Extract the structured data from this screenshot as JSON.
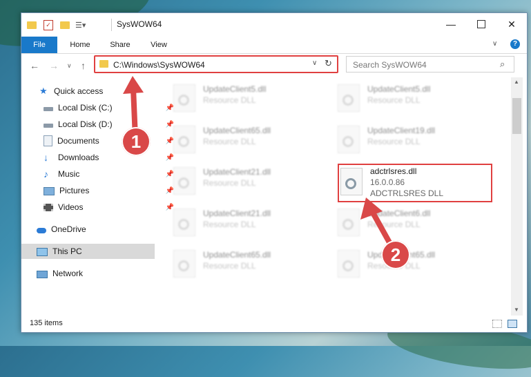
{
  "window": {
    "title": "SysWOW64"
  },
  "ribbon": {
    "tabs": [
      "File",
      "Home",
      "Share",
      "View"
    ]
  },
  "address": {
    "path": "C:\\Windows\\SysWOW64"
  },
  "search": {
    "placeholder": "Search SysWOW64"
  },
  "navpane": {
    "items": [
      {
        "label": "Quick access",
        "icon": "star-icon"
      },
      {
        "label": "Local Disk (C:)",
        "icon": "drive-icon",
        "pinned": true
      },
      {
        "label": "Local Disk (D:)",
        "icon": "drive-icon",
        "pinned": true
      },
      {
        "label": "Documents",
        "icon": "document-icon",
        "pinned": true
      },
      {
        "label": "Downloads",
        "icon": "download-icon",
        "pinned": true
      },
      {
        "label": "Music",
        "icon": "music-icon",
        "pinned": true
      },
      {
        "label": "Pictures",
        "icon": "pictures-icon",
        "pinned": true
      },
      {
        "label": "Videos",
        "icon": "videos-icon",
        "pinned": true
      },
      {
        "label": "OneDrive",
        "icon": "cloud-icon"
      },
      {
        "label": "This PC",
        "icon": "computer-icon",
        "selected": true
      },
      {
        "label": "Network",
        "icon": "network-icon"
      }
    ]
  },
  "files": {
    "left": [
      {
        "name": "UpdateClient5.dll",
        "type": "Resource DLL"
      },
      {
        "name": "UpdateClient65.dll",
        "type": "Resource DLL"
      },
      {
        "name": "UpdateClient21.dll",
        "type": "Resource DLL"
      },
      {
        "name": "UpdateClient21.dll",
        "type": "Resource DLL"
      },
      {
        "name": "UpdateClient65.dll",
        "type": "Resource DLL"
      }
    ],
    "right": [
      {
        "name": "UpdateClient5.dll",
        "type": "Resource DLL"
      },
      {
        "name": "UpdateClient19.dll",
        "type": "Resource DLL"
      },
      {
        "name": "UpdateClient6.dll",
        "type": "Resource DLL"
      },
      {
        "name": "UpdateClient65.dll",
        "type": "Resource DLL"
      }
    ],
    "highlighted": {
      "name": "adctrlsres.dll",
      "version": "16.0.0.86",
      "type": "ADCTRLSRES DLL"
    }
  },
  "status": {
    "count": "135 items"
  },
  "annotations": {
    "step1": "1",
    "step2": "2"
  },
  "colors": {
    "accent": "#1979ca",
    "highlight": "#e04040"
  }
}
